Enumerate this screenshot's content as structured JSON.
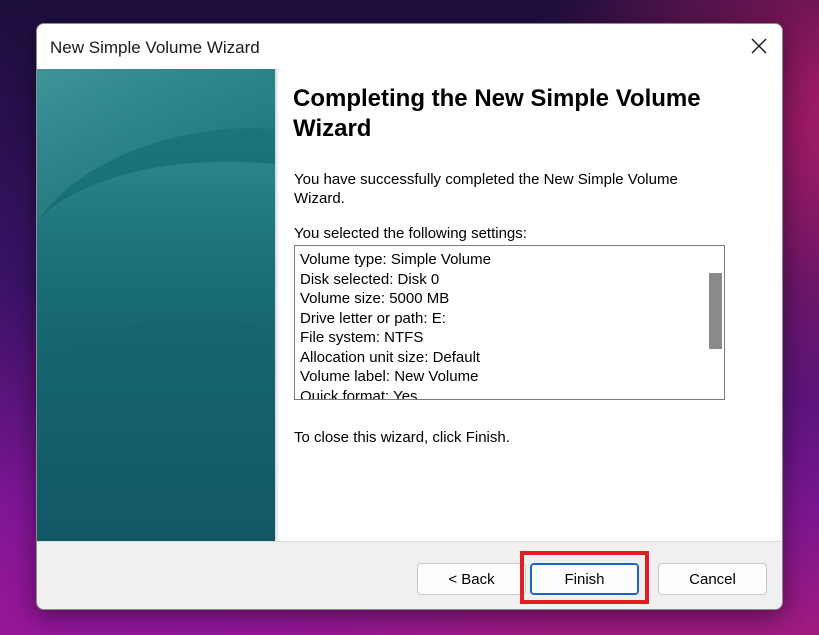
{
  "window": {
    "title": "New Simple Volume Wizard",
    "close_icon": "close-icon"
  },
  "main": {
    "heading": "Completing the New Simple Volume Wizard",
    "success_text": "You have successfully completed the New Simple Volume Wizard.",
    "settings_label": "You selected the following settings:",
    "settings": [
      "Volume type: Simple Volume",
      "Disk selected: Disk 0",
      "Volume size: 5000 MB",
      "Drive letter or path: E:",
      "File system: NTFS",
      "Allocation unit size: Default",
      "Volume label: New Volume",
      "Quick format: Yes"
    ],
    "close_hint": "To close this wizard, click Finish."
  },
  "footer": {
    "back_label": "< Back",
    "finish_label": "Finish",
    "cancel_label": "Cancel"
  },
  "colors": {
    "side_panel": "#176a73",
    "highlight": "#e01e24",
    "default_button_border": "#1a66c8"
  }
}
